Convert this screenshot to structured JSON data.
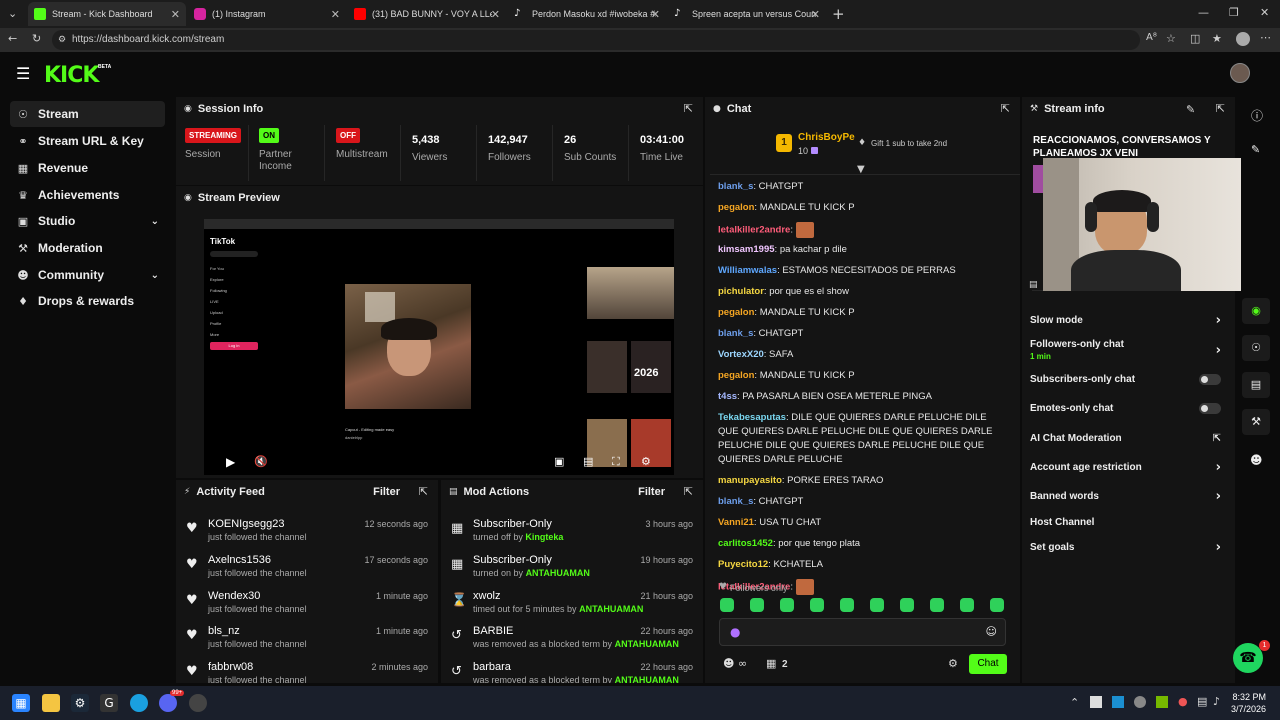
{
  "browser": {
    "tabs": [
      {
        "title": "Stream - Kick Dashboard",
        "color": "#53fc18"
      },
      {
        "title": "(1) Instagram",
        "color": "#d6249f"
      },
      {
        "title": "(31) BAD BUNNY - VOY A LLeVART",
        "color": "#ff0000"
      },
      {
        "title": "Perdon Masoku xd #iwobeka #ma",
        "color": "#ffffff"
      },
      {
        "title": "Spreen acepta un versus Counter",
        "color": "#ffffff"
      }
    ],
    "url": "https://dashboard.kick.com/stream"
  },
  "app": {
    "logo": "KICK",
    "beta": "BETA"
  },
  "sidebar": {
    "items": [
      {
        "label": "Stream",
        "icon": "broadcast-icon"
      },
      {
        "label": "Stream URL & Key",
        "icon": "link-icon"
      },
      {
        "label": "Revenue",
        "icon": "revenue-icon"
      },
      {
        "label": "Achievements",
        "icon": "trophy-icon"
      },
      {
        "label": "Studio",
        "icon": "studio-icon"
      },
      {
        "label": "Moderation",
        "icon": "wrench-icon"
      },
      {
        "label": "Community",
        "icon": "people-icon"
      },
      {
        "label": "Drops & rewards",
        "icon": "gift-icon"
      }
    ]
  },
  "session": {
    "title": "Session Info",
    "stats": [
      {
        "value": "STREAMING",
        "label": "Session"
      },
      {
        "value": "ON",
        "label": "Partner Income"
      },
      {
        "value": "OFF",
        "label": "Multistream"
      },
      {
        "value": "5,438",
        "label": "Viewers"
      },
      {
        "value": "142,947",
        "label": "Followers"
      },
      {
        "value": "26",
        "label": "Sub Counts"
      },
      {
        "value": "03:41:00",
        "label": "Time Live"
      }
    ],
    "colors": {
      "streaming": "#d9161b",
      "on": "#53fc18",
      "off": "#d9161b"
    }
  },
  "preview": {
    "title": "Stream Preview",
    "inner": {
      "site": "TikTok",
      "login": "Log in",
      "menu": [
        "For You",
        "Explore",
        "Following",
        "LIVE",
        "Upload",
        "Profile",
        "More"
      ],
      "caption": "Capcut - Editing made easy",
      "user": "danielrlpp",
      "tile_year": "2026"
    }
  },
  "activity": {
    "title": "Activity Feed",
    "filter": "Filter",
    "rows": [
      {
        "name": "KOENIgsegg23",
        "action": "just followed the channel",
        "time": "12 seconds ago"
      },
      {
        "name": "Axelncs1536",
        "action": "just followed the channel",
        "time": "17 seconds ago"
      },
      {
        "name": "Wendex30",
        "action": "just followed the channel",
        "time": "1 minute ago"
      },
      {
        "name": "bls_nz",
        "action": "just followed the channel",
        "time": "1 minute ago"
      },
      {
        "name": "fabbrw08",
        "action": "just followed the channel",
        "time": "2 minutes ago"
      }
    ]
  },
  "mod": {
    "title": "Mod Actions",
    "filter": "Filter",
    "rows": [
      {
        "title": "Subscriber-Only",
        "sub": "turned off by",
        "who": "Kingteka",
        "time": "3 hours ago",
        "icon": "gift-icon"
      },
      {
        "title": "Subscriber-Only",
        "sub": "turned on by",
        "who": "ANTAHUAMAN",
        "time": "19 hours ago",
        "icon": "gift-icon"
      },
      {
        "title": "xwolz",
        "sub": "timed out for 5 minutes by",
        "who": "ANTAHUAMAN",
        "time": "21 hours ago",
        "icon": "hourglass-icon"
      },
      {
        "title": "BARBIE",
        "sub": "was removed as a blocked term by",
        "who": "ANTAHUAMAN",
        "time": "22 hours ago",
        "icon": "undo-icon"
      },
      {
        "title": "barbara",
        "sub": "was removed as a blocked term by",
        "who": "ANTAHUAMAN",
        "time": "22 hours ago",
        "icon": "undo-icon"
      }
    ]
  },
  "chat": {
    "title": "Chat",
    "top_gifter": {
      "rank": "1",
      "name": "ChrisBoyPe",
      "count": "10",
      "tip": "Gift 1 sub to take 2nd"
    },
    "messages": [
      {
        "user": "blank_s",
        "color": "#6d9eeb",
        "text": "CHATGPT"
      },
      {
        "user": "pegalon",
        "color": "#f5a623",
        "text": "MANDALE TU KICK P"
      },
      {
        "user": "letalkiller2andre",
        "color": "#ff5d7a",
        "text": "",
        "emote": true
      },
      {
        "user": "kimsam1995",
        "color": "#f0c6ff",
        "text": "pa kachar p dile"
      },
      {
        "user": "Williamwalas",
        "color": "#5fa8ff",
        "text": "ESTAMOS NECESITADOS DE PERRAS"
      },
      {
        "user": "pichulator",
        "color": "#f5d742",
        "text": "por que es el show"
      },
      {
        "user": "pegalon",
        "color": "#f5a623",
        "text": "MANDALE TU KICK P"
      },
      {
        "user": "blank_s",
        "color": "#6d9eeb",
        "text": "CHATGPT"
      },
      {
        "user": "VortexX20",
        "color": "#9dd6ff",
        "text": "SAFA"
      },
      {
        "user": "pegalon",
        "color": "#f5a623",
        "text": "MANDALE TU KICK P"
      },
      {
        "user": "t4ss",
        "color": "#a5b8ff",
        "text": "PA PASARLA BIEN OSEA METERLE PINGA"
      },
      {
        "user": "Tekabesaputas",
        "color": "#7ad7f0",
        "text": "DILE QUE QUIERES DARLE PELUCHE DILE QUE QUIERES DARLE PELUCHE DILE QUE QUIERES DARLE PELUCHE DILE QUE QUIERES DARLE PELUCHE DILE QUE QUIERES DARLE PELUCHE"
      },
      {
        "user": "manupayasito",
        "color": "#f5d742",
        "text": "PORKE ERES TARAO"
      },
      {
        "user": "blank_s",
        "color": "#6d9eeb",
        "text": "CHATGPT"
      },
      {
        "user": "Vanni21",
        "color": "#f5a623",
        "text": "USA TU CHAT"
      },
      {
        "user": "carlitos1452",
        "color": "#53fc18",
        "text": "por que tengo plata"
      },
      {
        "user": "Puyecito12",
        "color": "#f5d742",
        "text": "KCHATELA"
      },
      {
        "user": "letalkiller2andre",
        "color": "#ff5d7a",
        "text": "",
        "emote": true
      }
    ],
    "followers_only": "Followers only",
    "pinned_count": "2",
    "send_label": "Chat"
  },
  "stream_info": {
    "title": "Stream info",
    "stream_title": "REACCIONAMOS, CONVERSAMOS Y PLANEAMOS JX VENI",
    "settings": [
      {
        "label": "Slow mode",
        "control": "arrow"
      },
      {
        "label": "Followers-only chat",
        "sub": "1 min",
        "control": "arrow"
      },
      {
        "label": "Subscribers-only chat",
        "control": "toggle"
      },
      {
        "label": "Emotes-only chat",
        "control": "toggle"
      },
      {
        "label": "AI Chat Moderation",
        "control": "external"
      },
      {
        "label": "Account age restriction",
        "control": "arrow"
      },
      {
        "label": "Banned words",
        "control": "arrow"
      },
      {
        "label": "Host Channel",
        "control": "none"
      },
      {
        "label": "Set goals",
        "control": "arrow"
      }
    ]
  },
  "taskbar": {
    "time": "8:32 PM",
    "date": "3/7/2026",
    "badge": "99+"
  }
}
